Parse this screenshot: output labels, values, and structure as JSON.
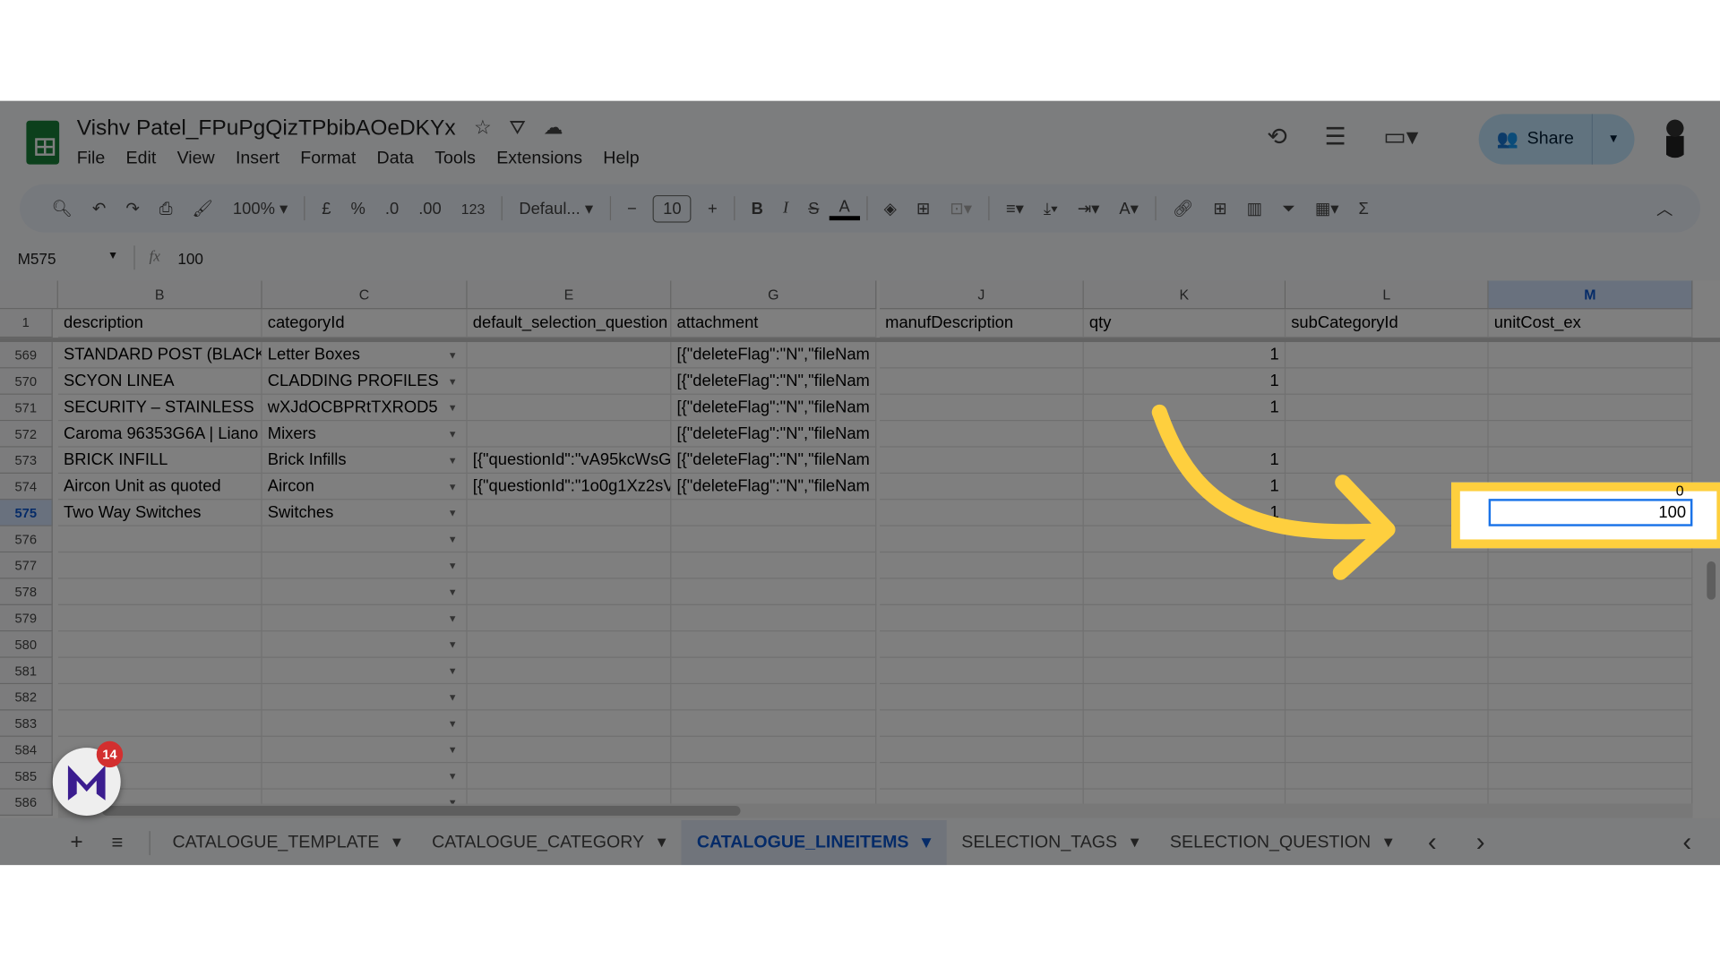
{
  "document": {
    "title": "Vishv Patel_FPuPgQizTPbibAOeDKYx"
  },
  "menu": [
    "File",
    "Edit",
    "View",
    "Insert",
    "Format",
    "Data",
    "Tools",
    "Extensions",
    "Help"
  ],
  "share": {
    "label": "Share"
  },
  "toolbar": {
    "zoom": "100%",
    "currency": "£",
    "percent": "%",
    "dec_decrease": ".0",
    "dec_increase": ".00",
    "number_format": "123",
    "font": "Defaul...",
    "font_size": "10",
    "bold": "B",
    "italic": "I"
  },
  "formula_bar": {
    "cell_ref": "M575",
    "fx": "fx",
    "value": "100"
  },
  "columns": [
    {
      "letter": "B",
      "header": "description"
    },
    {
      "letter": "C",
      "header": "categoryId"
    },
    {
      "letter": "E",
      "header": "default_selection_question"
    },
    {
      "letter": "G",
      "header": "attachment"
    },
    {
      "letter": "J",
      "header": "manufDescription"
    },
    {
      "letter": "K",
      "header": "qty"
    },
    {
      "letter": "L",
      "header": "subCategoryId"
    },
    {
      "letter": "M",
      "header": "unitCost_ex"
    }
  ],
  "header_row_number": "1",
  "rows": [
    {
      "n": "569",
      "B": "STANDARD POST (BLACK",
      "C": "Letter Boxes",
      "E": "",
      "G": "[{\"deleteFlag\":\"N\",\"fileNam",
      "K": "1",
      "M": ""
    },
    {
      "n": "570",
      "B": "SCYON LINEA",
      "C": "CLADDING PROFILES",
      "E": "",
      "G": "[{\"deleteFlag\":\"N\",\"fileNam",
      "K": "1",
      "M": ""
    },
    {
      "n": "571",
      "B": "SECURITY – STAINLESS",
      "C": "wXJdOCBPRtTXROD5",
      "E": "",
      "G": "[{\"deleteFlag\":\"N\",\"fileNam",
      "K": "1",
      "M": ""
    },
    {
      "n": "572",
      "B": " Caroma 96353G6A | Liano",
      "C": "Mixers",
      "E": "",
      "G": "[{\"deleteFlag\":\"N\",\"fileNam",
      "K": "",
      "M": ""
    },
    {
      "n": "573",
      "B": "BRICK INFILL",
      "C": "Brick Infills",
      "E": "[{\"questionId\":\"vA95kcWsG",
      "G": "[{\"deleteFlag\":\"N\",\"fileNam",
      "K": "1",
      "M": ""
    },
    {
      "n": "574",
      "B": "Aircon Unit as quoted",
      "C": "Aircon",
      "E": "[{\"questionId\":\"1o0g1Xz2sV",
      "G": "[{\"deleteFlag\":\"N\",\"fileNam",
      "K": "1",
      "M": "0"
    },
    {
      "n": "575",
      "B": "Two Way Switches",
      "C": "Switches",
      "E": "",
      "G": "",
      "K": "1",
      "M": "100"
    },
    {
      "n": "576"
    },
    {
      "n": "577"
    },
    {
      "n": "578"
    },
    {
      "n": "579"
    },
    {
      "n": "580"
    },
    {
      "n": "581"
    },
    {
      "n": "582"
    },
    {
      "n": "583"
    },
    {
      "n": "584"
    },
    {
      "n": "585"
    },
    {
      "n": "586"
    }
  ],
  "selected_cell": {
    "ref": "M575",
    "value": "100"
  },
  "sheet_tabs": [
    "CATALOGUE_TEMPLATE",
    "CATALOGUE_CATEGORY",
    "CATALOGUE_LINEITEMS",
    "SELECTION_TAGS",
    "SELECTION_QUESTION"
  ],
  "active_tab": "CATALOGUE_LINEITEMS",
  "notification_badge": "14",
  "colors": {
    "highlight": "#fecf3e",
    "selection": "#1a73e8",
    "sheets_green": "#188038"
  }
}
